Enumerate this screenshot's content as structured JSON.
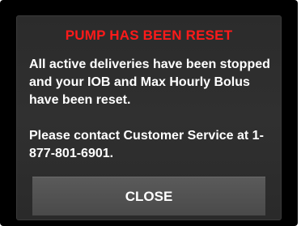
{
  "dialog": {
    "title": "PUMP HAS BEEN RESET",
    "message_line_1": "All active deliveries have been stopped and your IOB and Max Hourly Bolus have been reset.",
    "message_line_2": "Please contact Customer Service at 1-877-801-6901.",
    "close_label": "CLOSE"
  },
  "colors": {
    "title": "#ff1a1a",
    "background": "#000000",
    "panel": "#2e2e2e",
    "button": "#515151",
    "text": "#ffffff"
  }
}
